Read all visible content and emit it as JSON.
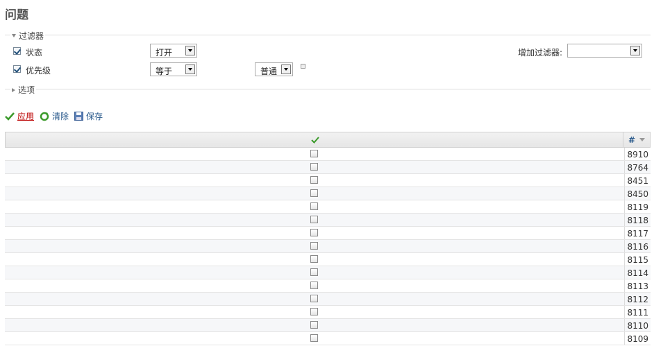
{
  "page": {
    "title": "问题"
  },
  "filters": {
    "legend": "过滤器",
    "rows": [
      {
        "label": "状态",
        "checked": true,
        "operator": "打开"
      },
      {
        "label": "优先级",
        "checked": true,
        "operator": "等于",
        "value": "普通"
      }
    ],
    "add_filter_label": "增加过滤器:",
    "add_filter_value": ""
  },
  "options": {
    "legend": "选项"
  },
  "actions": {
    "apply": "应用",
    "clear": "清除",
    "save": "保存"
  },
  "table": {
    "header_number": "#",
    "rows": [
      {
        "id": "8910"
      },
      {
        "id": "8764"
      },
      {
        "id": "8451"
      },
      {
        "id": "8450"
      },
      {
        "id": "8119"
      },
      {
        "id": "8118"
      },
      {
        "id": "8117"
      },
      {
        "id": "8116"
      },
      {
        "id": "8115"
      },
      {
        "id": "8114"
      },
      {
        "id": "8113"
      },
      {
        "id": "8112"
      },
      {
        "id": "8111"
      },
      {
        "id": "8110"
      },
      {
        "id": "8109"
      }
    ]
  },
  "colors": {
    "link": "#2a5a8c",
    "apply": "#bb0000",
    "check": "#3a9a2a"
  }
}
